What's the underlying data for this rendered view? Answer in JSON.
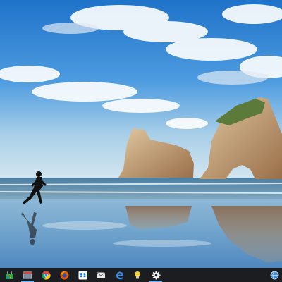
{
  "desktop": {
    "wallpaper": "beach-rocks-runner-wallpaper"
  },
  "taskbar": {
    "background": "#1b1d21",
    "pinned_apps": [
      {
        "name": "store-icon",
        "active": false
      },
      {
        "name": "app-window-icon",
        "active": true
      },
      {
        "name": "chrome-icon",
        "active": false
      },
      {
        "name": "firefox-icon",
        "active": false
      },
      {
        "name": "dropbox-icon",
        "active": false
      },
      {
        "name": "mail-icon",
        "active": false
      },
      {
        "name": "edge-icon",
        "active": false
      },
      {
        "name": "tips-lightbulb-icon",
        "active": false
      },
      {
        "name": "settings-gear-icon",
        "active": true
      }
    ],
    "tray": [
      {
        "name": "network-globe-icon"
      }
    ]
  }
}
